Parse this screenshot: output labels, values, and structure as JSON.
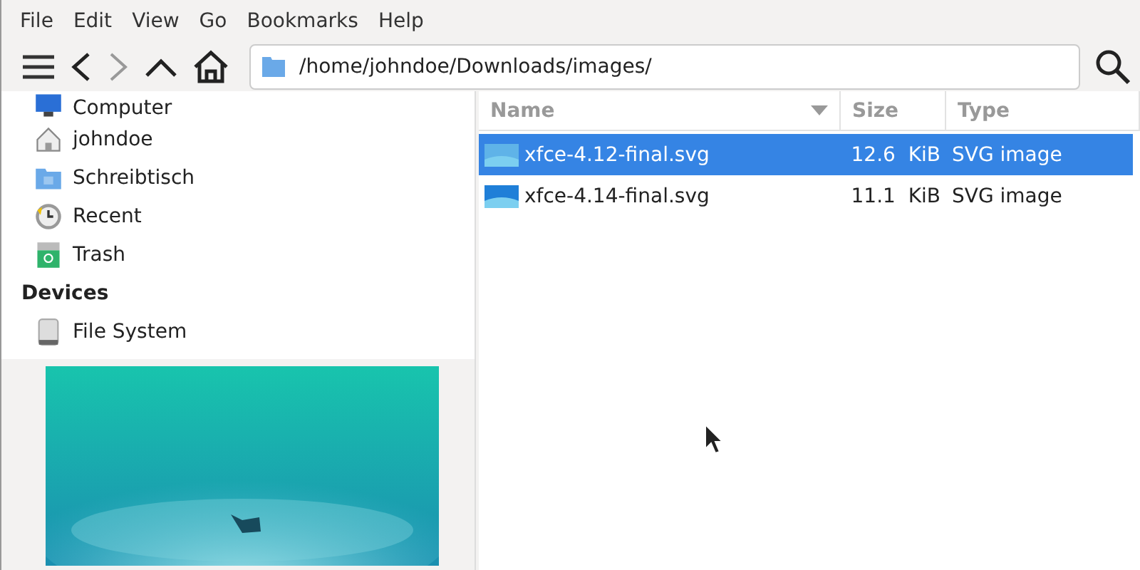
{
  "menu": [
    "File",
    "Edit",
    "View",
    "Go",
    "Bookmarks",
    "Help"
  ],
  "location": {
    "value": "/home/johndoe/Downloads/images/"
  },
  "sidebar": {
    "places": [
      {
        "kind": "computer",
        "label": "Computer",
        "selected": false
      },
      {
        "kind": "home",
        "label": "johndoe",
        "selected": false
      },
      {
        "kind": "desktop",
        "label": "Schreibtisch",
        "selected": false
      },
      {
        "kind": "recent",
        "label": "Recent",
        "selected": false
      },
      {
        "kind": "trash",
        "label": "Trash",
        "selected": false
      }
    ],
    "devices_heading": "Devices",
    "devices": [
      {
        "kind": "drive",
        "label": "File System",
        "selected": false
      }
    ]
  },
  "table": {
    "columns": [
      {
        "label": "Name",
        "sorted": true
      },
      {
        "label": "Size",
        "sorted": false
      },
      {
        "label": "Type",
        "sorted": false
      }
    ],
    "rows": [
      {
        "name": "xfce-4.12-final.svg",
        "size": "12.6  KiB",
        "type": "SVG image",
        "selected": true
      },
      {
        "name": "xfce-4.14-final.svg",
        "size": "11.1  KiB",
        "type": "SVG image",
        "selected": false
      }
    ]
  }
}
